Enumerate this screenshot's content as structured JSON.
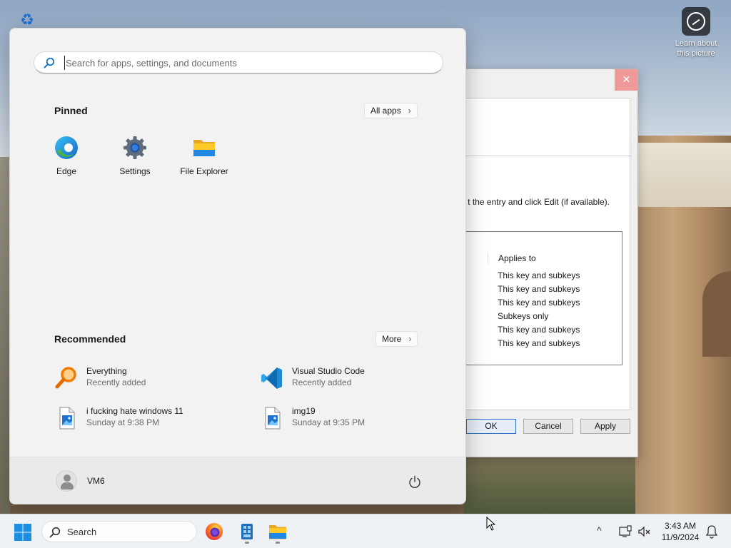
{
  "desktop": {
    "learn_widget_label": "Learn about this picture",
    "recycle_icon": "recycle-bin-icon"
  },
  "dialog": {
    "close_glyph": "✕",
    "instruction": "t the entry and click Edit (if available).",
    "column_header": "Applies to",
    "applies_to": [
      "This key and subkeys",
      "This key and subkeys",
      "This key and subkeys",
      "Subkeys only",
      "This key and subkeys",
      "This key and subkeys"
    ],
    "partial_text": "t",
    "buttons": {
      "ok": "OK",
      "cancel": "Cancel",
      "apply": "Apply"
    }
  },
  "start_menu": {
    "search_placeholder": "Search for apps, settings, and documents",
    "pinned_title": "Pinned",
    "all_apps_label": "All apps",
    "pinned_apps": [
      {
        "label": "Edge",
        "icon": "edge-icon"
      },
      {
        "label": "Settings",
        "icon": "gear-icon"
      },
      {
        "label": "File Explorer",
        "icon": "folder-icon"
      }
    ],
    "recommended_title": "Recommended",
    "more_label": "More",
    "recommended": [
      {
        "name": "Everything",
        "detail": "Recently added",
        "icon": "everything-search-icon"
      },
      {
        "name": "Visual Studio Code",
        "detail": "Recently added",
        "icon": "vscode-icon"
      },
      {
        "name": "i fucking hate windows 11",
        "detail": "Sunday at 9:38 PM",
        "icon": "image-file-icon"
      },
      {
        "name": "img19",
        "detail": "Sunday at 9:35 PM",
        "icon": "image-file-icon"
      }
    ],
    "user_name": "VM6"
  },
  "taskbar": {
    "search_label": "Search",
    "time": "3:43 AM",
    "date": "11/9/2024",
    "apps": [
      "firefox-icon",
      "application-icon",
      "file-explorer-icon"
    ],
    "tray_chevron": "^"
  },
  "colors": {
    "accent": "#0067c0",
    "start_bg": "#f2f2f2",
    "taskbar_bg": "#eef1f5",
    "close_button": "#f09999"
  }
}
